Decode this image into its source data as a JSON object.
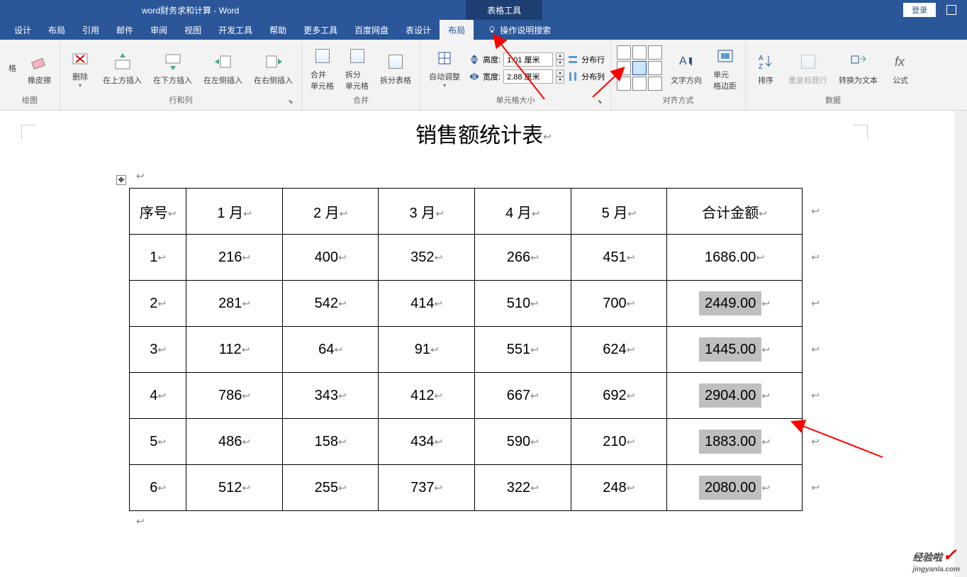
{
  "titlebar": {
    "doc_title": "word财务求和计算 - Word",
    "tool_tab": "表格工具",
    "login": "登录"
  },
  "menu": {
    "items": [
      "设计",
      "布局",
      "引用",
      "邮件",
      "审阅",
      "视图",
      "开发工具",
      "帮助",
      "更多工具",
      "百度网盘",
      "表设计",
      "布局"
    ],
    "active_index": 11,
    "tell_me": "操作说明搜索"
  },
  "ribbon": {
    "group_drawing": {
      "label": "绘图",
      "btn_grid": "格",
      "btn_eraser": "橡皮擦"
    },
    "group_rows_cols": {
      "label": "行和列",
      "btn_delete": "删除",
      "btn_insert_above": "在上方插入",
      "btn_insert_below": "在下方插入",
      "btn_insert_left": "在左侧插入",
      "btn_insert_right": "在右侧插入"
    },
    "group_merge": {
      "label": "合并",
      "btn_merge": "合并\n单元格",
      "btn_split": "拆分\n单元格",
      "btn_split_table": "拆分表格"
    },
    "group_cell_size": {
      "label": "单元格大小",
      "btn_autofit": "自动调整",
      "height_label": "高度:",
      "height_value": "1.01 厘米",
      "width_label": "宽度:",
      "width_value": "2.88 厘米",
      "btn_dist_rows": "分布行",
      "btn_dist_cols": "分布列"
    },
    "group_alignment": {
      "label": "对齐方式",
      "btn_text_dir": "文字方向",
      "btn_cell_margins": "单元\n格边距"
    },
    "group_data": {
      "label": "数据",
      "btn_sort": "排序",
      "btn_repeat_header": "重复标题行",
      "btn_convert": "转换为文本",
      "btn_formula": "公式"
    }
  },
  "document": {
    "title": "销售额统计表",
    "headers": [
      "序号",
      "1 月",
      "2 月",
      "3 月",
      "4 月",
      "5 月",
      "合计金额"
    ],
    "rows": [
      {
        "seq": "1",
        "m": [
          "216",
          "400",
          "352",
          "266",
          "451"
        ],
        "total": "1686.00",
        "hl": false
      },
      {
        "seq": "2",
        "m": [
          "281",
          "542",
          "414",
          "510",
          "700"
        ],
        "total": "2449.00",
        "hl": true
      },
      {
        "seq": "3",
        "m": [
          "112",
          "64",
          "91",
          "551",
          "624"
        ],
        "total": "1445.00",
        "hl": true
      },
      {
        "seq": "4",
        "m": [
          "786",
          "343",
          "412",
          "667",
          "692"
        ],
        "total": "2904.00",
        "hl": true
      },
      {
        "seq": "5",
        "m": [
          "486",
          "158",
          "434",
          "590",
          "210"
        ],
        "total": "1883.00",
        "hl": true
      },
      {
        "seq": "6",
        "m": [
          "512",
          "255",
          "737",
          "322",
          "248"
        ],
        "total": "2080.00",
        "hl": true
      }
    ]
  },
  "chart_data": {
    "type": "table",
    "title": "销售额统计表",
    "columns": [
      "序号",
      "1 月",
      "2 月",
      "3 月",
      "4 月",
      "5 月",
      "合计金额"
    ],
    "rows": [
      [
        1,
        216,
        400,
        352,
        266,
        451,
        1686.0
      ],
      [
        2,
        281,
        542,
        414,
        510,
        700,
        2449.0
      ],
      [
        3,
        112,
        64,
        91,
        551,
        624,
        1445.0
      ],
      [
        4,
        786,
        343,
        412,
        667,
        692,
        2904.0
      ],
      [
        5,
        486,
        158,
        434,
        590,
        210,
        1883.0
      ],
      [
        6,
        512,
        255,
        737,
        322,
        248,
        2080.0
      ]
    ]
  },
  "watermark": {
    "text": "经验啦",
    "url": "jingyanla.com"
  }
}
